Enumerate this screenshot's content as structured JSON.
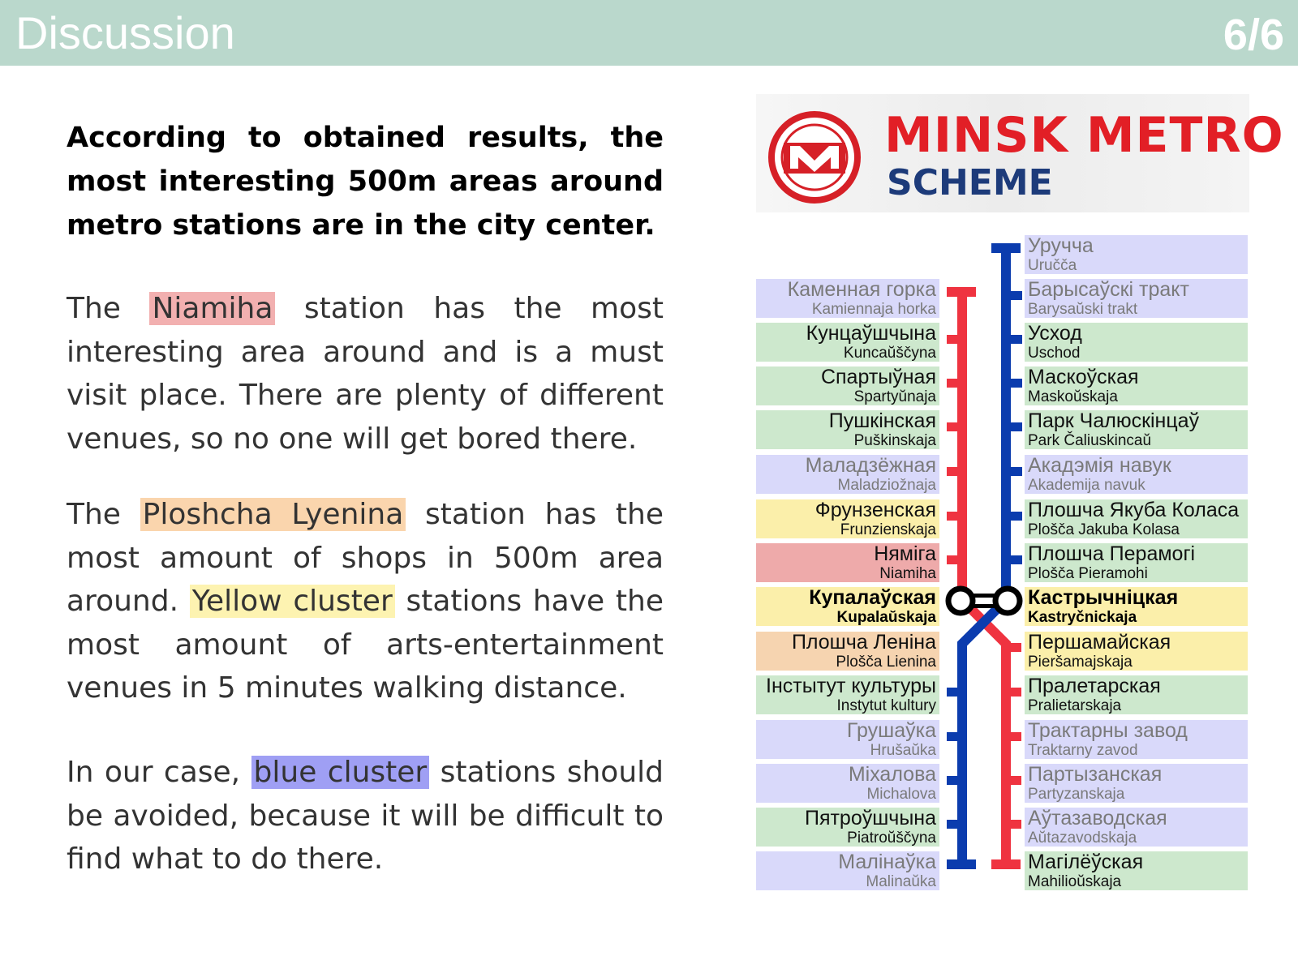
{
  "header": {
    "title": "Discussion",
    "page": "6/6"
  },
  "intro": "According to obtained results, the most interesting 500m areas around metro stations are in the city center.",
  "para1": {
    "pre": "The ",
    "highlight": "Niamiha",
    "post": " station has the most interesting area around and is a must visit place. There are plenty of different venues, so no one will get bored there."
  },
  "para2": {
    "pre": "The ",
    "highlight1": "Ploshcha Lyenina",
    "mid": " station has the most amount of shops in 500m area around. ",
    "highlight2": "Yellow cluster",
    "post": " stations have the most amount of arts-entertainment venues in 5 minutes walking distance."
  },
  "para3": {
    "pre": "In our case, ",
    "highlight": "blue cluster",
    "post": " stations should be avoided, because it will be difficult to find what to do there."
  },
  "highlight_colors": {
    "red": "#f2b0b0",
    "orange": "#fad5ad",
    "yellow": "#fdf3b1",
    "blue": "#9f9ff4"
  },
  "cluster_colors": {
    "blue": "#d9d9fa",
    "green": "#cde8cd",
    "yellow": "#fbefaa",
    "red": "#eeaaaa",
    "orange": "#f6d4b0"
  },
  "line_colors": {
    "red": "#ef3340",
    "blue": "#0b3cae"
  },
  "logo": {
    "title": "MINSK METRO",
    "subtitle": "SCHEME",
    "icon": "minsk-metro-m-logo"
  },
  "left_stations": [
    {
      "cyr": "Каменная горка",
      "lat": "Kamiennaja horka",
      "cluster": "blue",
      "style": "grey"
    },
    {
      "cyr": "Кунцаўшчына",
      "lat": "Kuncaŭščyna",
      "cluster": "green",
      "style": "dark"
    },
    {
      "cyr": "Спартыўная",
      "lat": "Spartyŭnaja",
      "cluster": "green",
      "style": "dark"
    },
    {
      "cyr": "Пушкінская",
      "lat": "Puškinskaja",
      "cluster": "green",
      "style": "dark"
    },
    {
      "cyr": "Маладзёжная",
      "lat": "Maladziožnaja",
      "cluster": "blue",
      "style": "grey"
    },
    {
      "cyr": "Фрунзенская",
      "lat": "Frunzienskaja",
      "cluster": "yellow",
      "style": "dark"
    },
    {
      "cyr": "Няміга",
      "lat": "Niamiha",
      "cluster": "red",
      "style": "dark"
    },
    {
      "cyr": "Купалаўская",
      "lat": "Kupalaŭskaja",
      "cluster": "yellow",
      "style": "bold"
    },
    {
      "cyr": "Плошча Леніна",
      "lat": "Plošča Lienina",
      "cluster": "orange",
      "style": "dark"
    },
    {
      "cyr": "Інстытут культуры",
      "lat": "Instytut kultury",
      "cluster": "green",
      "style": "dark"
    },
    {
      "cyr": "Грушаўка",
      "lat": "Hrušaŭka",
      "cluster": "blue",
      "style": "grey"
    },
    {
      "cyr": "Міхалова",
      "lat": "Michalova",
      "cluster": "blue",
      "style": "grey"
    },
    {
      "cyr": "Пятроўшчына",
      "lat": "Piatroŭščyna",
      "cluster": "green",
      "style": "dark"
    },
    {
      "cyr": "Малінаўка",
      "lat": "Malinaŭka",
      "cluster": "blue",
      "style": "grey"
    }
  ],
  "right_stations": [
    {
      "cyr": "Уручча",
      "lat": "Uručča",
      "cluster": "blue",
      "style": "grey"
    },
    {
      "cyr": "Барысаўскі тракт",
      "lat": "Barysaŭski trakt",
      "cluster": "blue",
      "style": "grey"
    },
    {
      "cyr": "Усход",
      "lat": "Uschod",
      "cluster": "green",
      "style": "dark"
    },
    {
      "cyr": "Маскоўская",
      "lat": "Maskoŭskaja",
      "cluster": "green",
      "style": "dark"
    },
    {
      "cyr": "Парк Чалюскінцаў",
      "lat": "Park Čaliuskincaŭ",
      "cluster": "green",
      "style": "dark"
    },
    {
      "cyr": "Акадэмія навук",
      "lat": "Akademija navuk",
      "cluster": "blue",
      "style": "grey"
    },
    {
      "cyr": "Плошча Якуба Коласа",
      "lat": "Plošča Jakuba Kolasa",
      "cluster": "green",
      "style": "dark"
    },
    {
      "cyr": "Плошча Перамогі",
      "lat": "Plošča Pieramohi",
      "cluster": "green",
      "style": "dark"
    },
    {
      "cyr": "Кастрычніцкая",
      "lat": "Kastryčnickaja",
      "cluster": "yellow",
      "style": "bold"
    },
    {
      "cyr": "Першамайская",
      "lat": "Pieršamajskaja",
      "cluster": "yellow",
      "style": "dark"
    },
    {
      "cyr": "Пралетарская",
      "lat": "Pralietarskaja",
      "cluster": "green",
      "style": "dark"
    },
    {
      "cyr": "Трактарны завод",
      "lat": "Traktarny zavod",
      "cluster": "blue",
      "style": "grey"
    },
    {
      "cyr": "Партызанская",
      "lat": "Partyzanskaja",
      "cluster": "blue",
      "style": "grey"
    },
    {
      "cyr": "Аўтазаводская",
      "lat": "Aŭtazavodskaja",
      "cluster": "blue",
      "style": "grey"
    },
    {
      "cyr": "Магілёўская",
      "lat": "Mahilioŭskaja",
      "cluster": "green",
      "style": "dark"
    }
  ]
}
